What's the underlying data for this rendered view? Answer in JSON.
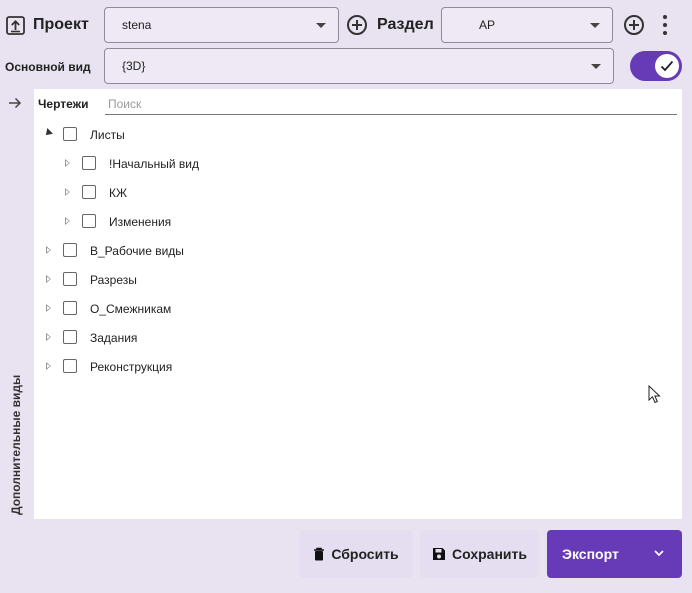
{
  "header": {
    "project_label": "Проект",
    "project_value": "stena",
    "section_label": "Раздел",
    "section_value": "АР"
  },
  "main_view": {
    "label": "Основной вид",
    "value": "{3D}",
    "toggle_on": true
  },
  "side_panel": {
    "title": "Дополнительные виды"
  },
  "drawings": {
    "label": "Чертежи",
    "search_placeholder": "Поиск",
    "tree": [
      {
        "label": "Листы",
        "level": 0,
        "state": "expanded"
      },
      {
        "label": "!Начальный вид",
        "level": 1,
        "state": "collapsed"
      },
      {
        "label": "КЖ",
        "level": 1,
        "state": "collapsed"
      },
      {
        "label": "Изменения",
        "level": 1,
        "state": "collapsed"
      },
      {
        "label": "В_Рабочие виды",
        "level": 0,
        "state": "collapsed"
      },
      {
        "label": "Разрезы",
        "level": 0,
        "state": "collapsed"
      },
      {
        "label": "О_Смежникам",
        "level": 0,
        "state": "collapsed"
      },
      {
        "label": "Задания",
        "level": 0,
        "state": "collapsed"
      },
      {
        "label": "Реконструкция",
        "level": 0,
        "state": "collapsed"
      }
    ]
  },
  "actions": {
    "reset_label": "Сбросить",
    "save_label": "Сохранить",
    "export_label": "Экспорт"
  },
  "colors": {
    "accent": "#673ab7",
    "background": "#e9e3f1",
    "button_light": "#e5def0"
  },
  "icons": {
    "export_app": "export-box-icon",
    "add": "plus-circle-icon",
    "menu": "more-vertical-icon",
    "expand_panel": "arrow-right-icon",
    "reset": "trash-icon",
    "save": "floppy-disk-icon",
    "export_menu": "chevron-down-icon"
  }
}
